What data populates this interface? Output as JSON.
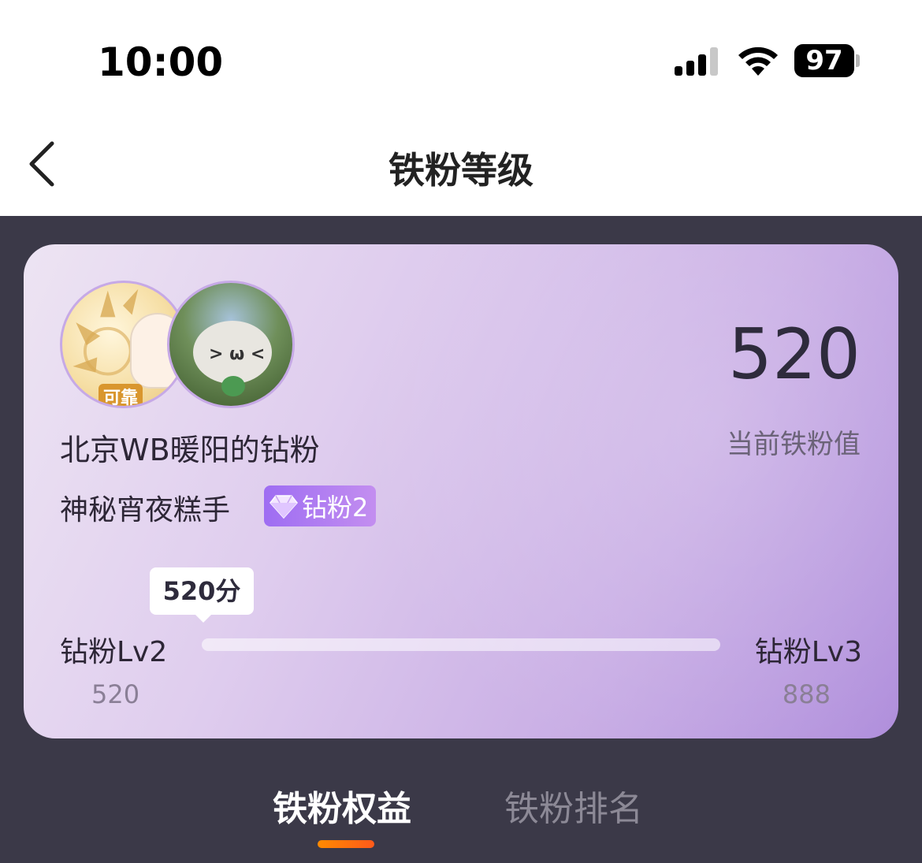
{
  "status_bar": {
    "time": "10:00",
    "battery": "97",
    "icons": [
      "signal-icon",
      "wifi-icon",
      "battery-icon"
    ]
  },
  "nav": {
    "title": "铁粉等级",
    "back_icon": "chevron-left-icon"
  },
  "card": {
    "username": "北京WB暖阳的钻粉",
    "subtitle": "神秘宵夜糕手",
    "badge_label": "钻粉2",
    "badge_icon": "diamond-icon",
    "avatar1_tag": "可靠",
    "avatar2_face": "> ω <",
    "score_value": "520",
    "score_label": "当前铁粉值",
    "tooltip": "520分",
    "level_current": "钻粉Lv2",
    "level_next": "钻粉Lv3",
    "level_min": "520",
    "level_max": "888",
    "progress_fraction": 0.0
  },
  "tabs": {
    "items": [
      {
        "label": "铁粉权益",
        "active": true
      },
      {
        "label": "铁粉排名",
        "active": false
      }
    ],
    "indicator_color": "#ff6a10"
  },
  "colors": {
    "background_dark": "#3b3948",
    "card_purple": "#c9aee5",
    "badge_purple": "#9e6df2"
  }
}
